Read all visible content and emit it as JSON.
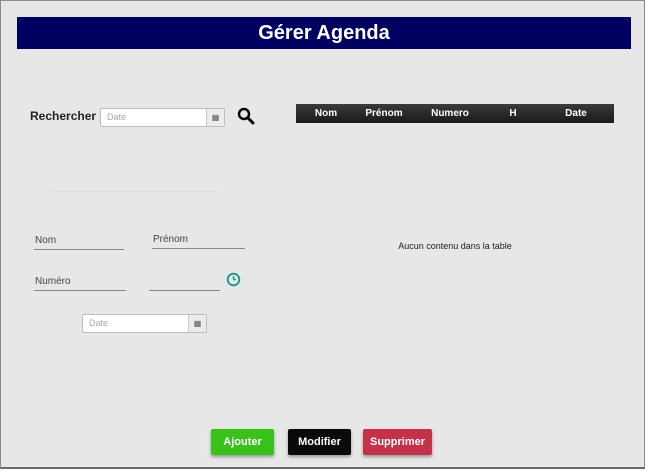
{
  "app": {
    "title": "Gérer Agenda"
  },
  "search": {
    "label": "Rechercher",
    "date_placeholder": "Date"
  },
  "form": {
    "nom_placeholder": "Nom",
    "prenom_placeholder": "Prénom",
    "numero_placeholder": "Numéro",
    "heure_placeholder": "",
    "date_placeholder": "Date"
  },
  "table": {
    "columns": [
      "Nom",
      "Prénom",
      "Numero",
      "H",
      "Date"
    ],
    "empty_message": "Aucun contenu dans la table"
  },
  "buttons": {
    "add": "Ajouter",
    "edit": "Modifier",
    "delete": "Supprimer"
  },
  "icons": {
    "search": "search-icon",
    "calendar": "calendar-icon",
    "clock": "clock-icon"
  },
  "colors": {
    "header_bg": "#000060",
    "add": "#38c21a",
    "edit": "#0a0a0a",
    "delete": "#c4324a",
    "clock": "#1a9a8a"
  }
}
